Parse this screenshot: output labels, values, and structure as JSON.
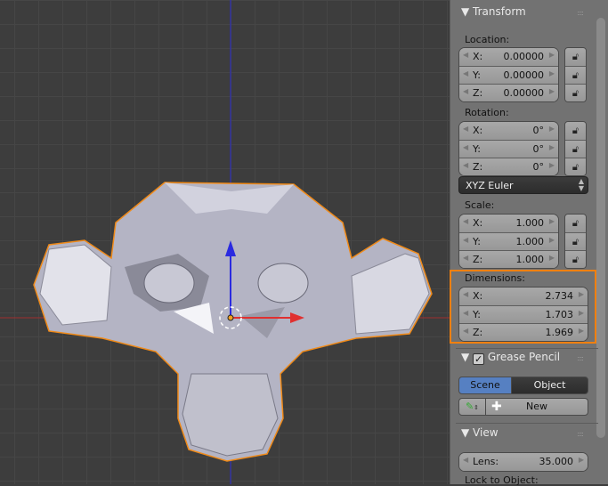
{
  "transform": {
    "title": "Transform",
    "location": {
      "label": "Location:",
      "fields": [
        {
          "axis": "X:",
          "value": "0.00000"
        },
        {
          "axis": "Y:",
          "value": "0.00000"
        },
        {
          "axis": "Z:",
          "value": "0.00000"
        }
      ]
    },
    "rotation": {
      "label": "Rotation:",
      "fields": [
        {
          "axis": "X:",
          "value": "0°"
        },
        {
          "axis": "Y:",
          "value": "0°"
        },
        {
          "axis": "Z:",
          "value": "0°"
        }
      ]
    },
    "rotation_mode": "XYZ Euler",
    "scale": {
      "label": "Scale:",
      "fields": [
        {
          "axis": "X:",
          "value": "1.000"
        },
        {
          "axis": "Y:",
          "value": "1.000"
        },
        {
          "axis": "Z:",
          "value": "1.000"
        }
      ]
    },
    "dimensions": {
      "label": "Dimensions:",
      "fields": [
        {
          "axis": "X:",
          "value": "2.734"
        },
        {
          "axis": "Y:",
          "value": "1.703"
        },
        {
          "axis": "Z:",
          "value": "1.969"
        }
      ]
    }
  },
  "grease_pencil": {
    "title": "Grease Pencil",
    "checked": true,
    "tabs": [
      "Scene",
      "Object"
    ],
    "new_label": "New"
  },
  "view": {
    "title": "View",
    "lens_label": "Lens:",
    "lens_value": "35.000",
    "lock_label": "Lock to Object:"
  },
  "colors": {
    "highlight": "#f08010",
    "x_axis": "#c83030",
    "z_axis": "#2a2ae0",
    "selected_tab": "#5680c2"
  }
}
